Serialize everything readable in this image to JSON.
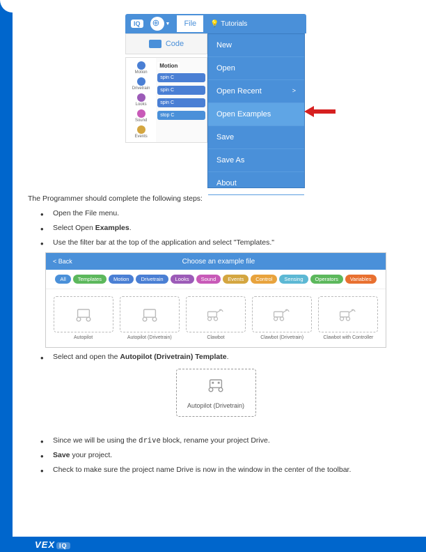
{
  "screenshot1": {
    "iq_label": "IQ",
    "file_tab": "File",
    "tutorials": "Tutorials",
    "code_tab": "Code",
    "categories": [
      {
        "label": "Motion",
        "color": "#4a7fd4"
      },
      {
        "label": "Drivetrain",
        "color": "#4a7fd4"
      },
      {
        "label": "Looks",
        "color": "#9c5bb8"
      },
      {
        "label": "Sound",
        "color": "#c85ab8"
      },
      {
        "label": "Events",
        "color": "#d4a640"
      }
    ],
    "motion_label": "Motion",
    "blocks": [
      "spin  C",
      "spin  C",
      "spin  C",
      "stop  C"
    ],
    "menu": [
      "New",
      "Open",
      "Open Recent",
      "Open Examples",
      "Save",
      "Save As",
      "About"
    ]
  },
  "screenshot2": {
    "back": "< Back",
    "title": "Choose an example file",
    "filters": [
      {
        "label": "All",
        "color": "#4a90d9"
      },
      {
        "label": "Templates",
        "color": "#5cb85c"
      },
      {
        "label": "Motion",
        "color": "#4a7fd4"
      },
      {
        "label": "Drivetrain",
        "color": "#4a7fd4"
      },
      {
        "label": "Looks",
        "color": "#9c5bb8"
      },
      {
        "label": "Sound",
        "color": "#c85ab8"
      },
      {
        "label": "Events",
        "color": "#d4a640"
      },
      {
        "label": "Control",
        "color": "#e8a33d"
      },
      {
        "label": "Sensing",
        "color": "#5cb8d4"
      },
      {
        "label": "Operators",
        "color": "#5cb85c"
      },
      {
        "label": "Variables",
        "color": "#e87030"
      }
    ],
    "cards": [
      "Autopilot",
      "Autopilot (Drivetrain)",
      "Clawbot",
      "Clawbot (Drivetrain)",
      "Clawbot with Controller"
    ]
  },
  "screenshot3": {
    "name": "Autopilot (Drivetrain)"
  },
  "text": {
    "intro": "The Programmer should complete the following steps:",
    "s1": "Open the File menu.",
    "s2a": "Select Open ",
    "s2b": "Examples",
    "s2c": ".",
    "s3": "Use the filter bar at the top of the application and select \"Templates.\"",
    "s4a": "Select and open the ",
    "s4b": "Autopilot (Drivetrain) Template",
    "s4c": ".",
    "s5a": "Since we will be using the ",
    "s5b": "drive",
    "s5c": " block, rename your project Drive.",
    "s6a": "Save",
    "s6b": " your project.",
    "s7": "Check to make sure the project name Drive is now in the window in the center of the toolbar."
  },
  "footer": {
    "brand": "VEX",
    "badge": "IQ"
  }
}
